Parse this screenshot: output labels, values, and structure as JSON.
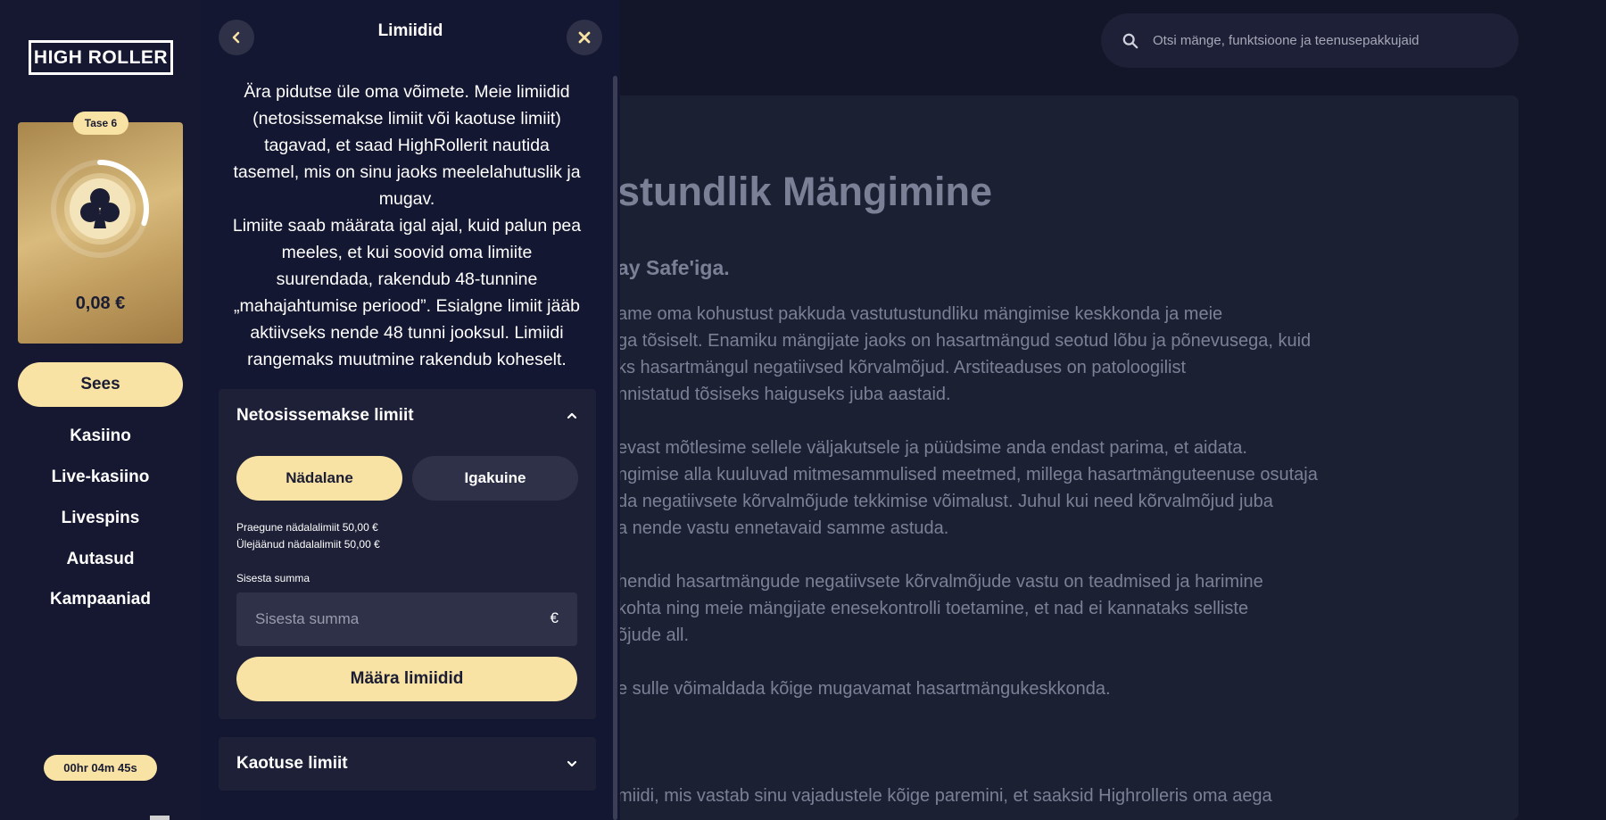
{
  "sidebar": {
    "logo": "HIGH ROLLER",
    "level_badge": "Tase 6",
    "level_progress": 0.3,
    "balance": "0,08 €",
    "status_button": "Sees",
    "nav": [
      "Kasiino",
      "Live-kasiino",
      "Livespins",
      "Autasud",
      "Kampaaniad"
    ],
    "session_timer": "00hr 04m 45s"
  },
  "search": {
    "placeholder": "Otsi mänge, funktsioone ja teenusepakkujaid"
  },
  "page": {
    "title_fragment": "stundlik Mängimine",
    "subtitle_fragment": "ay Safe'iga.",
    "paragraphs": [
      [
        "ame oma kohustust pakkuda vastutustundliku mängimise keskkonda ja meie",
        "ga tõsiselt. Enamiku mängijate jaoks on hasartmängud seotud lõbu ja põnevusega, kuid",
        "ks hasartmängul negatiivsed kõrvalmõjud. Arstiteaduses on patoloogilist",
        "nnistatud tõsiseks haiguseks juba aastaid."
      ],
      [
        "evast mõtlesime sellele väljakutsele ja püüdsime anda endast parima, et aidata.",
        "ngimise alla kuuluvad mitmesammulised meetmed, millega hasartmänguteenuse osutaja",
        "da negatiivsete kõrvalmõjude tekkimise võimalust. Juhul kui need kõrvalmõjud juba",
        "a nende vastu ennetavaid samme astuda."
      ],
      [
        "hendid hasartmängude negatiivsete kõrvalmõjude vastu on teadmised ja harimine",
        "kohta ning meie mängijate enesekontrolli toetamine, et nad ei kannataks selliste",
        "õjude all."
      ],
      [
        "e sulle võimaldada kõige mugavamat hasartmängukeskkonda."
      ],
      [
        "miidi, mis vastab sinu vajadustele kõige paremini, et saaksid Highrolleris oma aega"
      ]
    ]
  },
  "modal": {
    "title": "Limiidid",
    "description": [
      "Ära pidutse üle oma võimete. Meie limiidid",
      "(netosissemakse limiit või kaotuse limiit)",
      "tagavad, et saad HighRollerit nautida",
      "tasemel, mis on sinu jaoks meelelahutuslik ja",
      "mugav.",
      "Limiite saab määrata igal ajal, kuid palun pea",
      "meeles, et kui soovid oma limiite",
      "suurendada, rakendub 48-tunnine",
      "„mahajahtumise periood”. Esialgne limiit jääb",
      "aktiivseks nende 48 tunni jooksul. Limiidi",
      "rangemaks muutmine rakendub koheselt."
    ],
    "deposit_section": {
      "title": "Netosissemakse limiit",
      "period_weekly": "Nädalane",
      "period_monthly": "Igakuine",
      "current_limit": "Praegune nädalalimiit 50,00 €",
      "remaining_limit": "Ülejäänud nädalalimiit 50,00 €",
      "amount_label": "Sisesta summa",
      "amount_placeholder": "Sisesta summa",
      "currency": "€",
      "submit": "Määra limiidid"
    },
    "loss_section": {
      "title": "Kaotuse limiit"
    }
  },
  "colors": {
    "accent": "#f8e2a4",
    "background": "#131629",
    "panel": "#1d2036"
  }
}
